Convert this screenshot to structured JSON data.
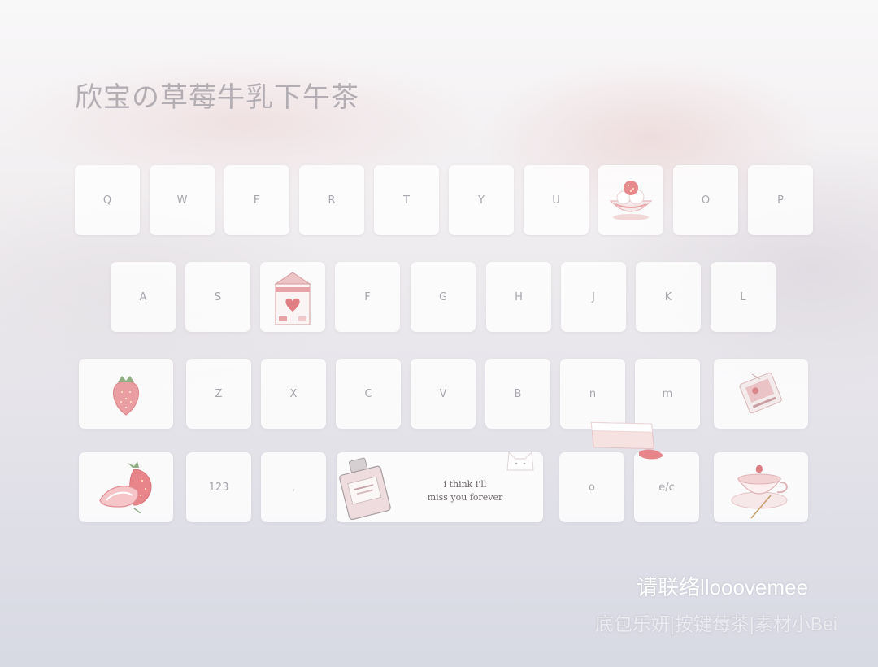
{
  "title": "欣宝の草莓牛乳下午茶",
  "rows": [
    [
      "Q",
      "W",
      "E",
      "R",
      "T",
      "Y",
      "U",
      "",
      "O",
      "P"
    ],
    [
      "A",
      "S",
      "",
      "F",
      "G",
      "H",
      "J",
      "K",
      "L"
    ],
    [
      "",
      "Z",
      "X",
      "C",
      "V",
      "B",
      "n",
      "m",
      ""
    ],
    [
      "",
      "123",
      ",",
      "",
      "o",
      "e/c",
      ""
    ]
  ],
  "space_text_line1": "i think i'll",
  "space_text_line2": "miss you forever",
  "footer_contact": "请联络llooovemee",
  "footer_credits": "底包乐妍|按键莓茶|素材小Bei",
  "icons": {
    "key_i": "strawberry-dessert-bowl-icon",
    "key_d": "strawberry-milk-carton-icon",
    "row3_left": "strawberry-icon",
    "row3_right": "tea-bag-icon",
    "row4_left": "sliced-strawberry-icon",
    "row4_right": "tea-cup-icon",
    "space_left": "perfume-bottle-icon",
    "space_right": "cat-icon",
    "floating": "cream-cake-icon"
  },
  "colors": {
    "accent": "#e8a3a6",
    "key_text": "#a8a6ac",
    "title_text": "#b3aeb3"
  }
}
